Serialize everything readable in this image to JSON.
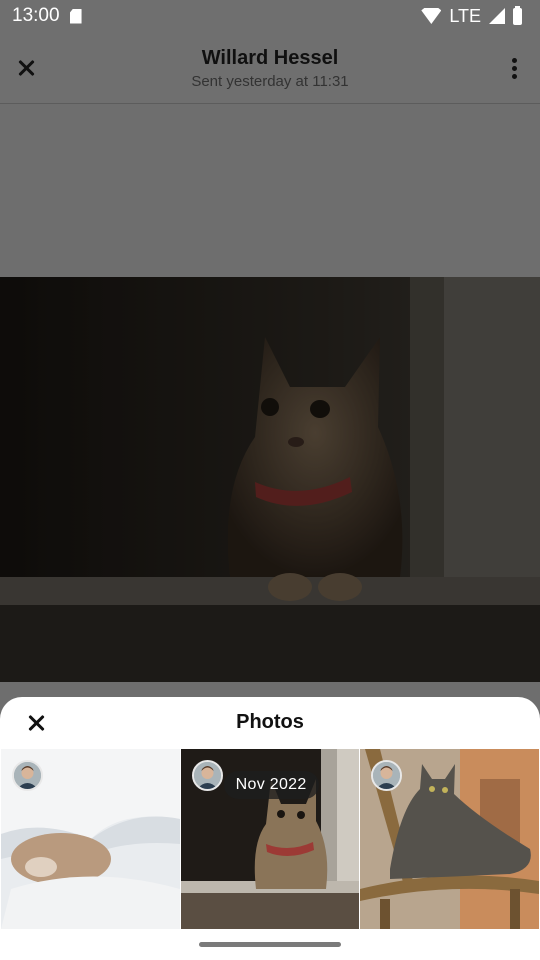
{
  "status_bar": {
    "time": "13:00",
    "network": "LTE",
    "icons": [
      "sd-card-icon",
      "wifi-icon",
      "signal-icon",
      "battery-icon"
    ]
  },
  "header": {
    "title": "Willard Hessel",
    "subtitle": "Sent yesterday at 11:31",
    "close_icon": "close-icon",
    "more_icon": "more-vert-icon"
  },
  "main_photo": {
    "subject": "tabby-cat-with-red-collar"
  },
  "sheet": {
    "title": "Photos",
    "close_icon": "close-icon",
    "thumbnails": [
      {
        "subject": "cat-sleeping-under-blanket",
        "badge": ""
      },
      {
        "subject": "tabby-cat-with-red-collar",
        "badge": "Nov 2022"
      },
      {
        "subject": "cat-lounging-on-chair",
        "badge": ""
      }
    ]
  },
  "colors": {
    "dim_overlay": "#6f6f6f",
    "sheet_bg": "#ffffff",
    "text_primary": "#111111"
  }
}
